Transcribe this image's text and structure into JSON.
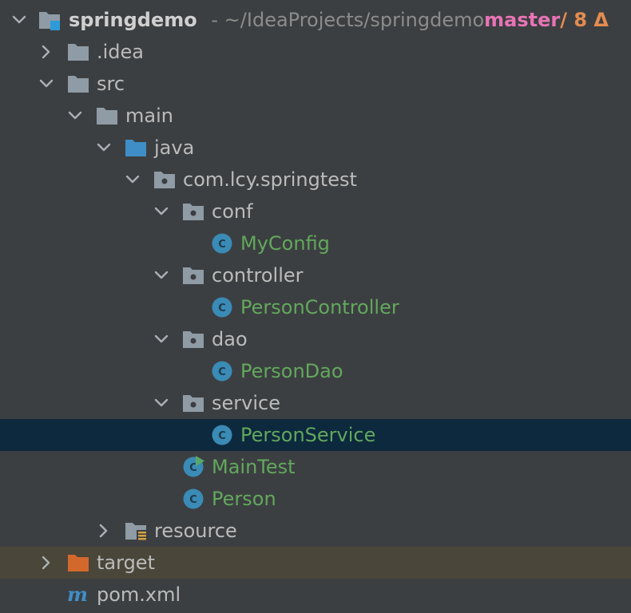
{
  "project": {
    "name": "springdemo",
    "path": "- ~/IdeaProjects/springdemo",
    "branch": "master",
    "changes": "/ 8 Δ"
  },
  "tree": {
    "idea": ".idea",
    "src": "src",
    "main": "main",
    "java": "java",
    "package": "com.lcy.springtest",
    "conf": "conf",
    "myconfig": "MyConfig",
    "controller": "controller",
    "person_controller": "PersonController",
    "dao": "dao",
    "person_dao": "PersonDao",
    "service": "service",
    "person_service": "PersonService",
    "main_test": "MainTest",
    "person": "Person",
    "resource": "resource",
    "target": "target",
    "pom": "pom.xml"
  },
  "colors": {
    "background": "#3c3f41",
    "selected_row": "#0d293e",
    "excluded_row": "#4a4639",
    "class_name_green": "#62a85d",
    "branch_pink": "#e874b6",
    "changes_orange": "#e38c4f",
    "folder_gray": "#8f9ba5",
    "source_blue": "#3f8ec7",
    "excluded_orange": "#d3682d",
    "class_icon_teal": "#3a8bb5"
  }
}
